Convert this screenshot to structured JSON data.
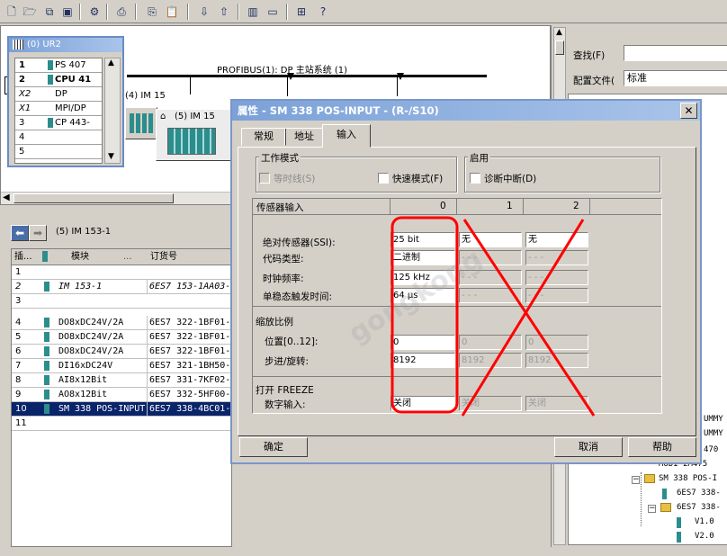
{
  "toolbar": {
    "icons": [
      "new-icon",
      "open-icon",
      "network-icon",
      "save-icon",
      "compile-icon",
      "print-icon",
      "copy-icon",
      "paste-icon",
      "download-icon",
      "upload-icon",
      "catalog-icon",
      "window-icon",
      "network-view-icon",
      "help-icon"
    ]
  },
  "rack": {
    "title": "(0) UR2",
    "rows": [
      {
        "slot": "1",
        "module": "PS 407"
      },
      {
        "slot": "2",
        "module": "CPU 41"
      },
      {
        "slot": "X2",
        "module": "DP"
      },
      {
        "slot": "X1",
        "module": "MPI/DP"
      },
      {
        "slot": "3",
        "module": "CP 443-"
      },
      {
        "slot": "4",
        "module": ""
      },
      {
        "slot": "5",
        "module": ""
      }
    ]
  },
  "network": {
    "bus_label": "PROFIBUS(1): DP 主站系统 (1)",
    "station4": "(4) IM 15",
    "station5": "(5) IM 15"
  },
  "catalog": {
    "find_label": "查找(F)",
    "profile_label": "配置文件(",
    "profile_value": "标准",
    "tree_items": [
      "UMMY",
      "UMMY",
      "470",
      "MODI 2M475",
      "SM 338 POS-I",
      "6ES7 338-",
      "6ES7 338-",
      "V1.0",
      "V2.0"
    ]
  },
  "detail": {
    "station": "(5)  IM 153-1",
    "headers": {
      "slot": "插...",
      "module": "模块",
      "order": "订货号"
    },
    "rows": [
      {
        "slot": "1",
        "module": "",
        "order": ""
      },
      {
        "slot": "2",
        "module": "IM 153-1",
        "order": "6ES7 153-1AA03-"
      },
      {
        "slot": "3",
        "module": "",
        "order": ""
      },
      {
        "slot": "4",
        "module": "DO8xDC24V/2A",
        "order": "6ES7 322-1BF01-0"
      },
      {
        "slot": "5",
        "module": "DO8xDC24V/2A",
        "order": "6ES7 322-1BF01-0"
      },
      {
        "slot": "6",
        "module": "DO8xDC24V/2A",
        "order": "6ES7 322-1BF01-0"
      },
      {
        "slot": "7",
        "module": "DI16xDC24V",
        "order": "6ES7 321-1BH50-0"
      },
      {
        "slot": "8",
        "module": "AI8x12Bit",
        "order": "6ES7 331-7KF02-0"
      },
      {
        "slot": "9",
        "module": "AO8x12Bit",
        "order": "6ES7 332-5HF00-0"
      },
      {
        "slot": "10",
        "module": "SM 338 POS-INPUT",
        "order": "6ES7 338-4BC01-0"
      },
      {
        "slot": "11",
        "module": "",
        "order": ""
      }
    ]
  },
  "dialog": {
    "title": "属性 - SM 338 POS-INPUT - (R-/S10)",
    "tabs": [
      "常规",
      "地址",
      "输入"
    ],
    "mode_group": "工作模式",
    "isochronous": "等时线(S)",
    "fast_mode": "快速模式(F)",
    "enable_group": "启用",
    "diag_interrupt": "诊断中断(D)",
    "sensor_header": "传感器输入",
    "col0": "0",
    "col1": "1",
    "col2": "2",
    "abs_encoder": "绝对传感器(SSI):",
    "code_type": "代码类型:",
    "clock_freq": "时钟频率:",
    "monoflop": "单稳态触发时间:",
    "scaling": "缩放比例",
    "position": "位置[0..12]:",
    "steps": "步进/旋转:",
    "freeze": "打开 FREEZE",
    "digital_input": "数字输入:",
    "v_abs0": "25 bit",
    "v_abs1": "无",
    "v_abs2": "无",
    "v_code0": "二进制",
    "v_clk0": "125 kHz",
    "v_mono0": "64 μs",
    "v_dash": "- - -",
    "v_pos0": "0",
    "v_pos1": "0",
    "v_pos2": "0",
    "v_steps0": "8192",
    "v_steps1": "8192",
    "v_steps2": "8192",
    "v_di0": "关闭",
    "v_di1": "关闭",
    "v_di2": "关闭",
    "ok": "确定",
    "cancel": "取消",
    "help": "帮助",
    "close": "✕"
  },
  "annotations": {
    "box_color": "#ff0000",
    "cross_color": "#ff0000"
  }
}
